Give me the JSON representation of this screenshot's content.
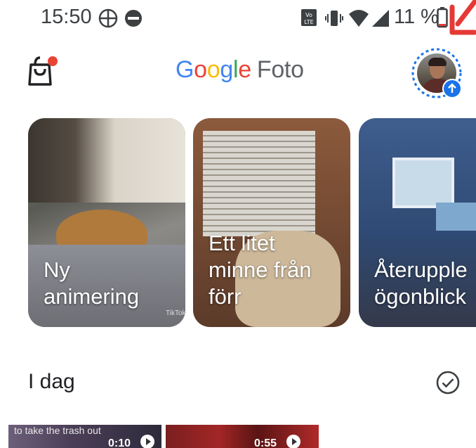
{
  "status_bar": {
    "time": "15:50",
    "battery": "11 %",
    "icons": [
      "pinwheel-icon",
      "dnd-icon",
      "volte-icon",
      "vibrate-icon",
      "wifi-icon",
      "signal-icon",
      "battery-low-icon"
    ]
  },
  "app_bar": {
    "title_google": [
      "G",
      "o",
      "o",
      "g",
      "l",
      "e"
    ],
    "title_colors": [
      "#4285F4",
      "#EA4335",
      "#FBBC05",
      "#4285F4",
      "#34A853",
      "#EA4335"
    ],
    "title_suffix": "Foto",
    "notification_badge_color": "#EA4335",
    "backup_badge_color": "#1a73e8"
  },
  "memories": [
    {
      "line1": "Ny",
      "line2": "animering",
      "watermark": "TikTok"
    },
    {
      "line1": "Ett litet",
      "line2": "minne från",
      "line3": "förr"
    },
    {
      "line1": "Återupple",
      "line2": "ögonblick"
    }
  ],
  "section": {
    "title": "I dag"
  },
  "videos": [
    {
      "caption": "to take the trash out",
      "duration": "0:10"
    },
    {
      "caption": "",
      "duration": "0:55"
    }
  ],
  "annotation_color": "#e53935"
}
